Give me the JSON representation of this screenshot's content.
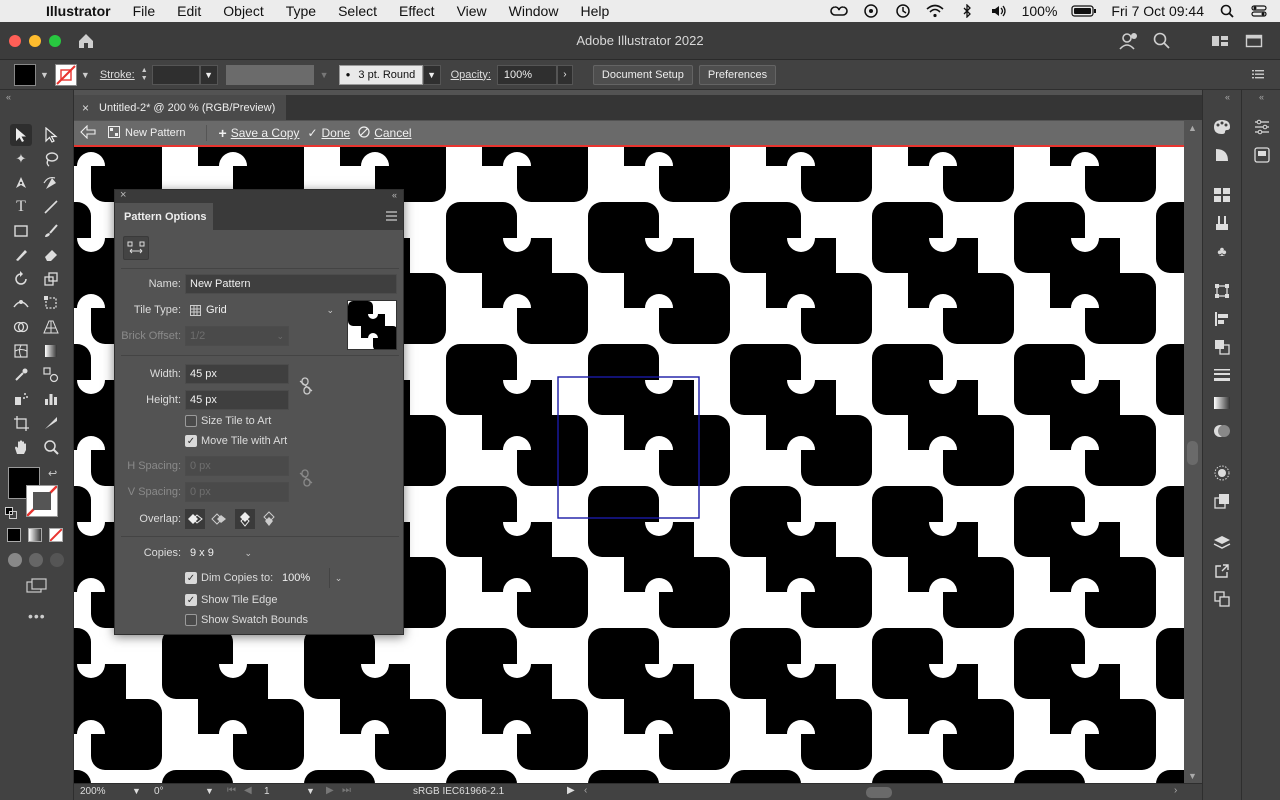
{
  "menubar": {
    "app_name": "Illustrator",
    "items": [
      "File",
      "Edit",
      "Object",
      "Type",
      "Select",
      "Effect",
      "View",
      "Window",
      "Help"
    ],
    "battery": "100%",
    "datetime": "Fri 7 Oct  09:44"
  },
  "window": {
    "title": "Adobe Illustrator 2022"
  },
  "controlbar": {
    "stroke_label": "Stroke:",
    "brush_value": "3 pt. Round",
    "opacity_label": "Opacity:",
    "opacity_value": "100%",
    "document_setup": "Document Setup",
    "preferences": "Preferences"
  },
  "document_tab": {
    "title": "Untitled-2* @ 200 % (RGB/Preview)"
  },
  "pattern_bar": {
    "pattern_name": "New Pattern",
    "save_copy": "Save a Copy",
    "done": "Done",
    "cancel": "Cancel"
  },
  "pattern_panel": {
    "title": "Pattern Options",
    "name_label": "Name:",
    "name_value": "New Pattern",
    "tile_type_label": "Tile Type:",
    "tile_type_value": "Grid",
    "brick_offset_label": "Brick Offset:",
    "brick_offset_value": "1/2",
    "width_label": "Width:",
    "width_value": "45 px",
    "height_label": "Height:",
    "height_value": "45 px",
    "size_tile_to_art": {
      "label": "Size Tile to Art",
      "checked": false
    },
    "move_tile_with_art": {
      "label": "Move Tile with Art",
      "checked": true
    },
    "h_spacing_label": "H Spacing:",
    "h_spacing_value": "0 px",
    "v_spacing_label": "V Spacing:",
    "v_spacing_value": "0 px",
    "overlap_label": "Overlap:",
    "copies_label": "Copies:",
    "copies_value": "9 x 9",
    "dim_copies": {
      "label": "Dim Copies to:",
      "checked": true,
      "value": "100%"
    },
    "show_tile_edge": {
      "label": "Show Tile Edge",
      "checked": true
    },
    "show_swatch_bounds": {
      "label": "Show Swatch Bounds",
      "checked": false
    }
  },
  "statusbar": {
    "zoom": "200%",
    "rotation": "0°",
    "artboard": "1",
    "profile": "sRGB IEC61966-2.1"
  },
  "colors": {
    "accent_red": "#e8342f",
    "tile_edge": "#1a1aa6",
    "pattern_fill": "#000000",
    "canvas_bg": "#ffffff"
  }
}
